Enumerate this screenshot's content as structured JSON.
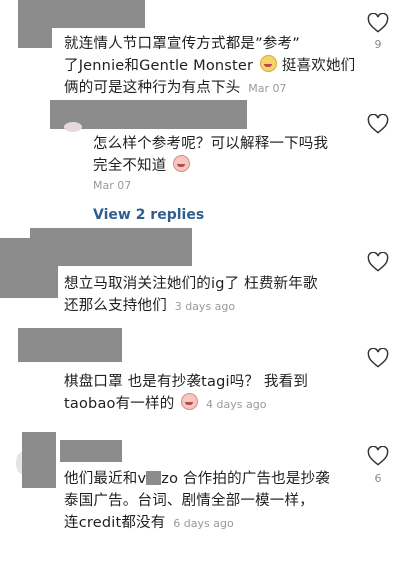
{
  "comments": [
    {
      "lines": [
        "就连情人节口罩宣传方式都是”参考”",
        "了Jennie和Gentle Monster"
      ],
      "line3": "挺喜欢她们",
      "line4": "俩的可是这种行为有点下头",
      "time": "Mar 07",
      "likes": "9"
    },
    {
      "lines": [
        "怎么样个参考呢？可以解释一下吗我",
        "完全不知道"
      ],
      "time": "Mar 07",
      "likes": ""
    },
    {
      "view_replies": "View 2 replies"
    },
    {
      "lines": [
        "想立马取消关注她们的ig了 枉费新年歌",
        "还那么支持他们"
      ],
      "time": "3 days ago",
      "likes": ""
    },
    {
      "lines": [
        "棋盘口罩 也是有抄袭tagi吗？ 我看到",
        "taobao有一样的"
      ],
      "time": "4 days ago",
      "likes": ""
    },
    {
      "lines": [
        "他们最近和v",
        "zo 合作拍的广告也是抄袭",
        "泰国广告。台词、剧情全部一模一样，",
        "连credit都没有"
      ],
      "time": "6 days ago",
      "likes": "6"
    }
  ],
  "icons": {
    "like": "heart-outline-icon",
    "emoji": "crying-face-icon"
  },
  "colors": {
    "redact": "#8c8c8c",
    "link": "#2f5f8f",
    "meta": "#9a9a9a"
  }
}
